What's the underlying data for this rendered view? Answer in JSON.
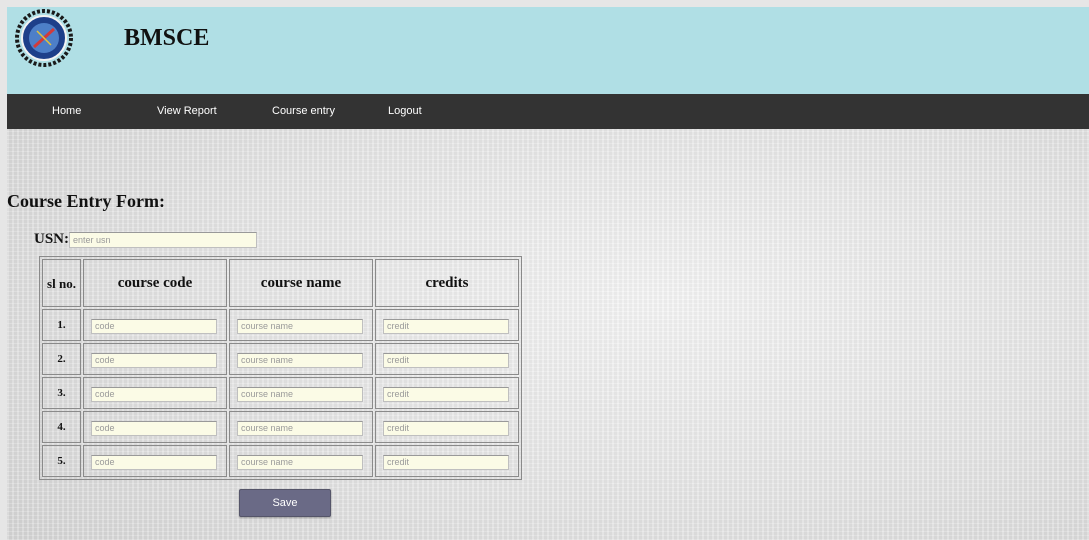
{
  "header": {
    "brand": "BMSCE"
  },
  "nav": [
    {
      "label": "Home"
    },
    {
      "label": "View Report"
    },
    {
      "label": "Course entry"
    },
    {
      "label": "Logout"
    }
  ],
  "form": {
    "title": "Course Entry Form:",
    "usn_label": "USN:",
    "usn_placeholder": "enter usn",
    "headers": {
      "sl": "sl no.",
      "code": "course code",
      "name": "course name",
      "credits": "credits"
    },
    "rows": [
      {
        "sl": "1.",
        "code_ph": "code",
        "name_ph": "course name",
        "credit_ph": "credit"
      },
      {
        "sl": "2.",
        "code_ph": "code",
        "name_ph": "course name",
        "credit_ph": "credit"
      },
      {
        "sl": "3.",
        "code_ph": "code",
        "name_ph": "course name",
        "credit_ph": "credit"
      },
      {
        "sl": "4.",
        "code_ph": "code",
        "name_ph": "course name",
        "credit_ph": "credit"
      },
      {
        "sl": "5.",
        "code_ph": "code",
        "name_ph": "course name",
        "credit_ph": "credit"
      }
    ],
    "save_label": "Save"
  }
}
